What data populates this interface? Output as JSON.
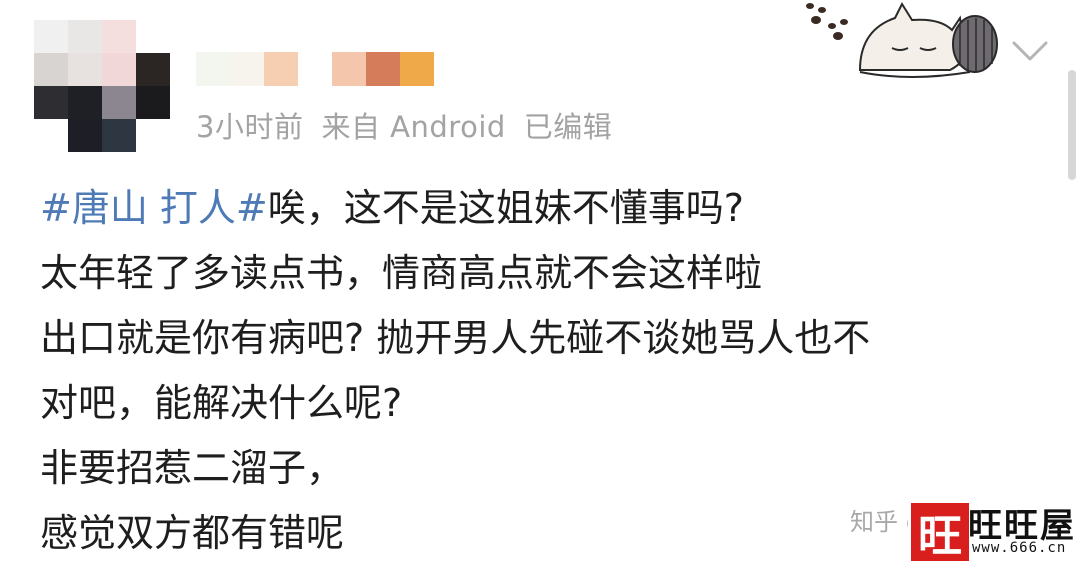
{
  "post": {
    "meta": {
      "time": "3小时前",
      "source": "来自 Android",
      "edited": "已编辑"
    },
    "content": {
      "hashtag": "#唐山 打人#",
      "lines": [
        "唉，这不是这姐妹不懂事吗?",
        "太年轻了多读点书，情商高点就不会这样啦",
        "出口就是你有病吧? 抛开男人先碰不谈她骂人也不",
        "对吧，能解决什么呢?",
        "非要招惹二溜子，",
        "感觉双方都有错呢"
      ]
    }
  },
  "watermark": {
    "zhihu": "知乎 @",
    "logo_char": "旺",
    "logo_text": "旺旺屋",
    "logo_url": "www.666.cn"
  },
  "colors": {
    "hashtag": "#4e7bb6",
    "meta": "#a3a3a3",
    "text": "#1e1e1e",
    "logo_red": "#d91e1e"
  },
  "icons": {
    "chevron": "chevron-down-icon",
    "sticker": "sleeping-cat-sticker"
  }
}
